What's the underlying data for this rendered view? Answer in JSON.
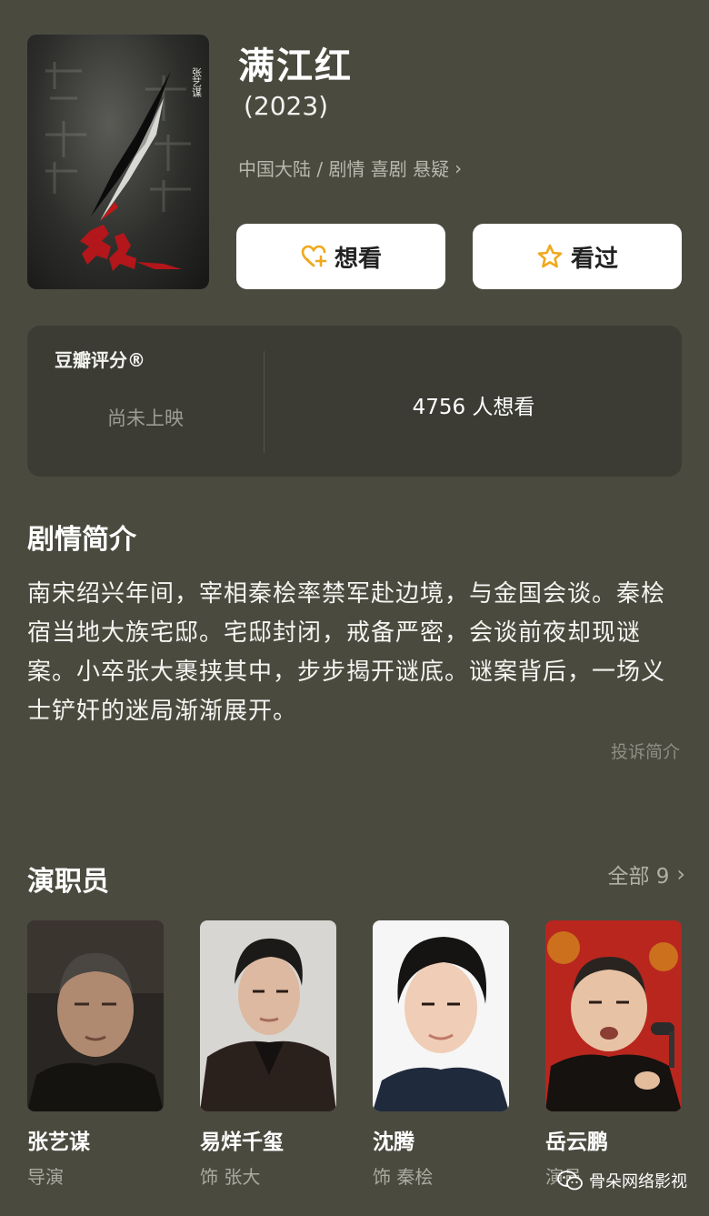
{
  "movie": {
    "title": "满江红",
    "year": "(2023)",
    "meta": "中国大陆 / 剧情 喜剧 悬疑",
    "meta_chevron": "›",
    "poster_director_mark": "张艺谋",
    "poster_title_mark": "满江红"
  },
  "actions": {
    "want_label": "想看",
    "seen_label": "看过"
  },
  "rating": {
    "label": "豆瓣评分®",
    "status": "尚未上映",
    "want_count": "4756 人想看"
  },
  "synopsis": {
    "heading": "剧情简介",
    "text": "南宋绍兴年间，宰相秦桧率禁军赴边境，与金国会谈。秦桧宿当地大族宅邸。宅邸封闭，戒备严密，会谈前夜却现谜案。小卒张大裹挟其中，步步揭开谜底。谜案背后，一场义士铲奸的迷局渐渐展开。",
    "complain": "投诉简介"
  },
  "cast": {
    "heading": "演职员",
    "all_label": "全部 9",
    "chevron": "›",
    "members": [
      {
        "name": "张艺谋",
        "role": "导演"
      },
      {
        "name": "易烊千玺",
        "role": "饰 张大"
      },
      {
        "name": "沈腾",
        "role": "饰 秦桧"
      },
      {
        "name": "岳云鹏",
        "role": "演员"
      }
    ]
  },
  "watermark": {
    "text": "骨朵网络影视"
  },
  "colors": {
    "background": "#4a4a3f",
    "card": "#3c3c35",
    "accent": "#f0a81c"
  }
}
